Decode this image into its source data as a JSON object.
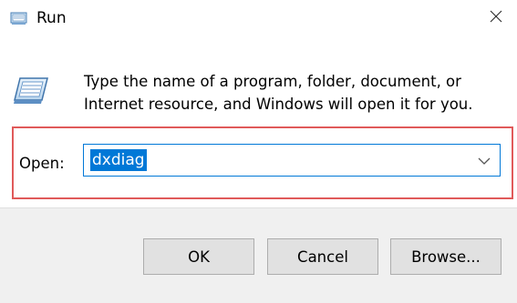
{
  "window": {
    "title": "Run",
    "title_icon": "run-icon",
    "close_icon": "close-icon"
  },
  "body": {
    "icon": "run-dialog-icon",
    "description": "Type the name of a program, folder, document, or Internet resource, and Windows will open it for you."
  },
  "open_field": {
    "label": "Open:",
    "value": "dxdiag",
    "dropdown_icon": "chevron-down-icon"
  },
  "buttons": {
    "ok": "OK",
    "cancel": "Cancel",
    "browse": "Browse..."
  },
  "colors": {
    "accent": "#0078d7",
    "highlight_border": "#e05a5a",
    "dialog_background": "#f0f0f0",
    "button_face": "#e1e1e1"
  }
}
